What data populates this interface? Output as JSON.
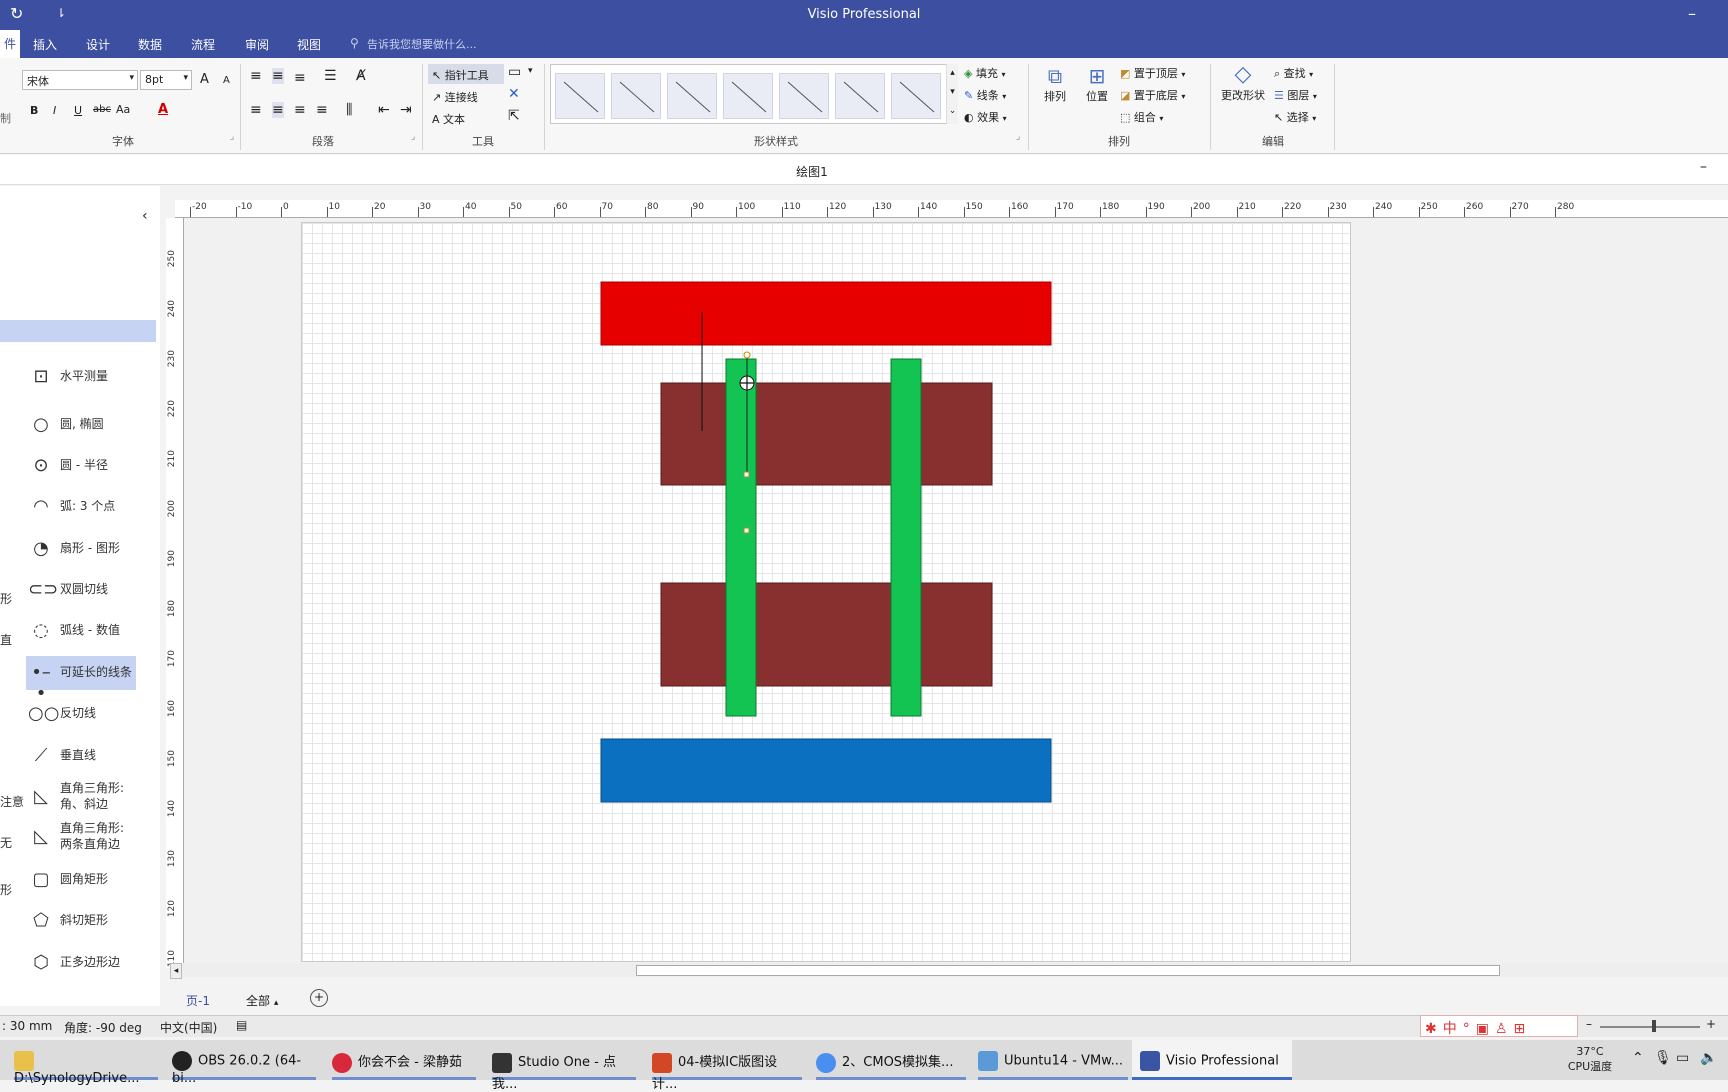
{
  "window": {
    "title": "Visio Professional"
  },
  "menu": {
    "file_tab": "件",
    "items": [
      "插入",
      "设计",
      "数据",
      "流程",
      "审阅",
      "视图"
    ],
    "tell_me": "告诉我您想要做什么..."
  },
  "ribbon": {
    "font": {
      "name": "宋体",
      "size": "8pt",
      "group_label": "字体",
      "bold": "B",
      "italic": "I",
      "underline": "U",
      "strike": "abc",
      "case": "Aa",
      "grow": "A",
      "shrink": "A",
      "color_glyph": "A"
    },
    "paragraph": {
      "group_label": "段落"
    },
    "tools": {
      "group_label": "工具",
      "pointer": "指针工具",
      "connector": "连接线",
      "text": "文本"
    },
    "styles": {
      "group_label": "形状样式",
      "thumbnail_count": 7
    },
    "format": {
      "fill": "填充",
      "line": "线条",
      "effect": "效果"
    },
    "arrange": {
      "group_label": "排列",
      "arrange_btn": "排列",
      "position": "位置",
      "bring_front": "置于顶层",
      "send_back": "置于底层",
      "group": "组合"
    },
    "edit": {
      "group_label": "编辑",
      "change_shape": "更改形状",
      "find": "查找",
      "layers": "图层",
      "select": "选择"
    },
    "clipped_left": "制"
  },
  "document": {
    "title": "绘图1",
    "minimize": "–"
  },
  "shapes_pane": {
    "collapse_glyph": "‹",
    "items": [
      {
        "label": "水平测量",
        "icon": "horizontal-measure-icon"
      },
      {
        "label": "圆, 椭圆",
        "icon": "circle-icon"
      },
      {
        "label": "圆 - 半径",
        "icon": "circle-radius-icon"
      },
      {
        "label": "弧: 3 个点",
        "icon": "arc-3pt-icon"
      },
      {
        "label": "扇形 - 图形",
        "icon": "sector-icon"
      },
      {
        "label": "双圆切线",
        "icon": "double-circle-icon"
      },
      {
        "label": "弧线 - 数值",
        "icon": "arc-value-icon"
      },
      {
        "label": "可延长的线条",
        "icon": "extendable-line-icon",
        "selected": true
      },
      {
        "label": "反切线",
        "icon": "reverse-tangent-icon"
      },
      {
        "label": "垂直线",
        "icon": "perpendicular-icon"
      },
      {
        "label": "直角三角形: 角、斜边",
        "icon": "right-triangle-icon"
      },
      {
        "label": "直角三角形: 两条直角边",
        "icon": "right-triangle-legs-icon"
      },
      {
        "label": "圆角矩形",
        "icon": "rounded-rect-icon"
      },
      {
        "label": "斜切矩形",
        "icon": "bevel-rect-icon"
      },
      {
        "label": "正多边形边",
        "icon": "polygon-icon"
      }
    ],
    "clipped": [
      "形",
      "直",
      "注意",
      "无",
      "形"
    ]
  },
  "ruler": {
    "top_labels": [
      "-20",
      "-10",
      "0",
      "10",
      "20",
      "30",
      "40",
      "50",
      "60",
      "70",
      "80",
      "90",
      "100",
      "110",
      "120",
      "130",
      "140",
      "150",
      "160",
      "170",
      "180",
      "190",
      "200",
      "210",
      "220",
      "230",
      "240",
      "250",
      "260",
      "270",
      "280"
    ],
    "left_labels": [
      "250",
      "240",
      "230",
      "220",
      "210",
      "200",
      "190",
      "180",
      "170",
      "160",
      "150",
      "140",
      "130",
      "120",
      "110"
    ]
  },
  "drawing": {
    "colors": {
      "red": "#e60000",
      "maroon": "#883030",
      "green": "#14c452",
      "blue": "#0c70c0"
    }
  },
  "page_tabs": {
    "current": "页-1",
    "all": "全部",
    "add": "+"
  },
  "status": {
    "length": ": 30 mm",
    "angle": "角度: -90 deg",
    "language": "中文(中国)"
  },
  "ime": {
    "glyphs": "中"
  },
  "taskbar": {
    "items": [
      {
        "label": "D:\\SynologyDrive...",
        "color": "#e8c04a"
      },
      {
        "label": "OBS 26.0.2 (64-bi...",
        "color": "#222222"
      },
      {
        "label": "你会不会 - 梁静茹",
        "color": "#d8283c"
      },
      {
        "label": "Studio One - 点我...",
        "color": "#333333"
      },
      {
        "label": "04-模拟IC版图设计...",
        "color": "#d24726"
      },
      {
        "label": "2、CMOS模拟集...",
        "color": "#4a8ff0"
      },
      {
        "label": "Ubuntu14 - VMw...",
        "color": "#5a9ad8"
      },
      {
        "label": "Visio Professional",
        "color": "#3955a3",
        "active": true
      }
    ],
    "temp": "37°C",
    "temp_label": "CPU温度"
  }
}
